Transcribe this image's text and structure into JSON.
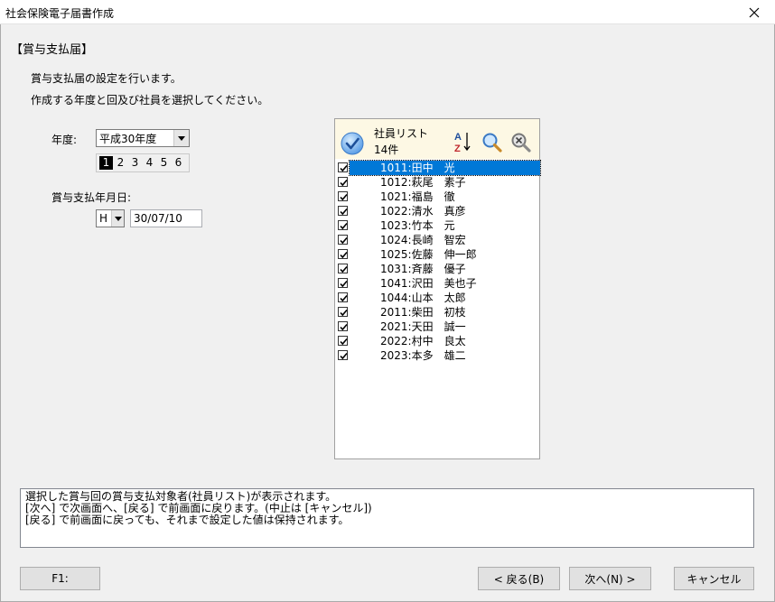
{
  "window": {
    "title": "社会保険電子届書作成"
  },
  "section_title": "【賞与支払届】",
  "description": {
    "line1": "賞与支払届の設定を行います。",
    "line2": "作成する年度と回及び社員を選択してください。"
  },
  "year": {
    "label": "年度:",
    "selected": "平成30年度"
  },
  "rounds": {
    "items": [
      "1",
      "2",
      "3",
      "4",
      "5",
      "6"
    ],
    "selected": "1"
  },
  "payment_date": {
    "label": "賞与支払年月日:",
    "era": "H",
    "value": "30/07/10"
  },
  "employee_list": {
    "title": "社員リスト",
    "count": "14件",
    "rows": [
      {
        "text": "1011:田中　光",
        "checked": true,
        "selected": true
      },
      {
        "text": "1012:萩尾　素子",
        "checked": true,
        "selected": false
      },
      {
        "text": "1021:福島　徹",
        "checked": true,
        "selected": false
      },
      {
        "text": "1022:清水　真彦",
        "checked": true,
        "selected": false
      },
      {
        "text": "1023:竹本　元",
        "checked": true,
        "selected": false
      },
      {
        "text": "1024:長崎　智宏",
        "checked": true,
        "selected": false
      },
      {
        "text": "1025:佐藤　伸一郎",
        "checked": true,
        "selected": false
      },
      {
        "text": "1031:斉藤　優子",
        "checked": true,
        "selected": false
      },
      {
        "text": "1041:沢田　美也子",
        "checked": true,
        "selected": false
      },
      {
        "text": "1044:山本　太郎",
        "checked": true,
        "selected": false
      },
      {
        "text": "2011:柴田　初枝",
        "checked": true,
        "selected": false
      },
      {
        "text": "2021:天田　誠一",
        "checked": true,
        "selected": false
      },
      {
        "text": "2022:村中　良太",
        "checked": true,
        "selected": false
      },
      {
        "text": "2023:本多　雄二",
        "checked": true,
        "selected": false
      }
    ]
  },
  "info": {
    "line1": "選択した賞与回の賞与支払対象者(社員リスト)が表示されます。",
    "line2": "[次へ] で次画面へ、[戻る] で前画面に戻ります。(中止は [キャンセル])",
    "line3": "[戻る] で前画面に戻っても、それまで設定した値は保持されます。"
  },
  "buttons": {
    "f1": "F1:",
    "back": "< 戻る(B)",
    "next": "次へ(N) >",
    "cancel": "キャンセル"
  },
  "colors": {
    "selection": "#0078d7",
    "panel_header": "#fdf8e4",
    "window_bg": "#f0f0f0"
  }
}
